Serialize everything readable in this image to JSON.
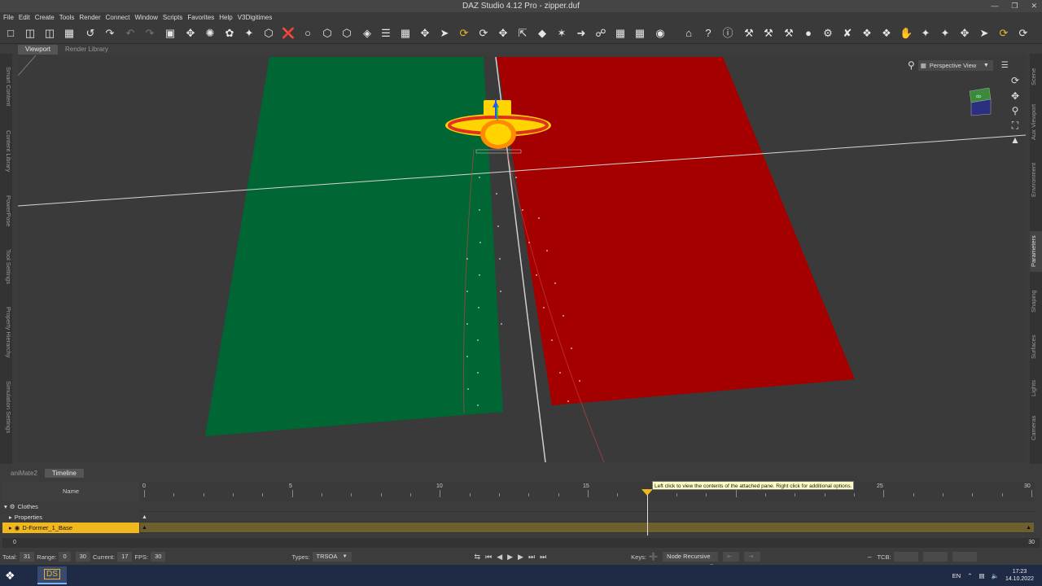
{
  "window": {
    "title": "DAZ Studio 4.12 Pro - zipper.duf",
    "controls": [
      "—",
      "❐",
      "✕"
    ]
  },
  "menu": [
    "File",
    "Edit",
    "Create",
    "Tools",
    "Render",
    "Connect",
    "Window",
    "Scripts",
    "Favorites",
    "Help",
    "V3Digitimes"
  ],
  "top_tabs": [
    {
      "label": "Viewport",
      "active": true
    },
    {
      "label": "Render Library",
      "active": false
    }
  ],
  "left_dock": [
    "Smart Content",
    "Content Library",
    "PowerPose",
    "Tool Settings",
    "Property Hierarchy",
    "Simulation Settings"
  ],
  "right_dock": [
    "Scene",
    "Aux Viewport",
    "Environment",
    "Parameters",
    "Shaping",
    "Surfaces",
    "Lights",
    "Cameras"
  ],
  "viewport": {
    "camera": "Perspective View"
  },
  "bottom_tabs": [
    {
      "label": "aniMate2",
      "active": false
    },
    {
      "label": "Timeline",
      "active": true
    }
  ],
  "timeline": {
    "name_header": "Name",
    "ruler_labels": [
      "0",
      "5",
      "10",
      "15",
      "25",
      "30"
    ],
    "tree": [
      {
        "label": "Clothes",
        "expander": "▾",
        "icon": "gear-icon"
      },
      {
        "label": "Properties",
        "expander": "▸",
        "icon": ""
      },
      {
        "label": "D-Former_1_Base",
        "expander": "▸",
        "icon": "dformer-icon"
      }
    ],
    "tooltip": "Left click to view the contents of the attached pane. Right click for additional options.",
    "range_start": "0",
    "range_end": "30",
    "current_frame": 17,
    "total_frames": 30
  },
  "status": {
    "total_label": "Total:",
    "total": "31",
    "range_label": "Range:",
    "range_from": "0",
    "range_to": "30",
    "current_label": "Current:",
    "current": "17",
    "fps_label": "FPS:",
    "fps": "30",
    "types_label": "Types:",
    "types": "TRSOA",
    "keys_label": "Keys:",
    "node_mode": "Node Recursive",
    "tcb_label": "TCB:"
  },
  "taskbar": {
    "app": "DS",
    "lang": "EN",
    "time": "17:23",
    "date": "14.10.2022"
  }
}
